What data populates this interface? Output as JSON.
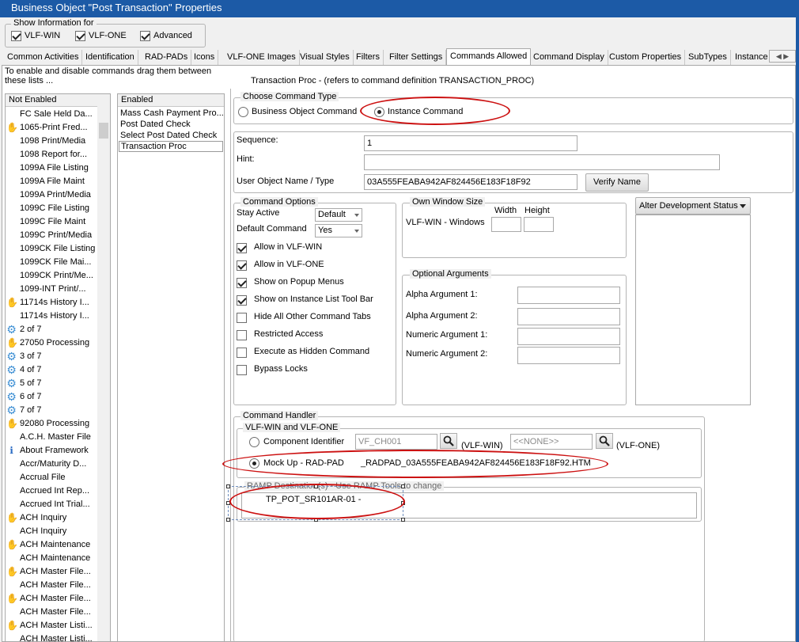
{
  "window": {
    "title": "Business Object \"Post Transaction\" Properties"
  },
  "show_info": {
    "legend": "Show Information for",
    "options": [
      {
        "label": "VLF-WIN",
        "checked": true
      },
      {
        "label": "VLF-ONE",
        "checked": true
      },
      {
        "label": "Advanced",
        "checked": true
      }
    ]
  },
  "tabs": [
    {
      "label": "Common Activities"
    },
    {
      "label": "Identification"
    },
    {
      "label": "RAD-PADs"
    },
    {
      "label": "Icons"
    },
    {
      "label": "VLF-ONE Images"
    },
    {
      "label": "Visual Styles"
    },
    {
      "label": "Filters"
    },
    {
      "label": "Filter Settings"
    },
    {
      "label": "Commands Allowed",
      "active": true
    },
    {
      "label": "Command Display"
    },
    {
      "label": "Custom Properties"
    },
    {
      "label": "SubTypes"
    },
    {
      "label": "Instance"
    }
  ],
  "instructions": "To enable and disable commands drag them between these lists ...",
  "transaction_header": "Transaction Proc - (refers to command definition TRANSACTION_PROC)",
  "not_enabled": {
    "header": "Not Enabled",
    "items": [
      {
        "label": "FC Sale Held Da...",
        "icon": "none"
      },
      {
        "label": "1065-Print Fred...",
        "icon": "hand-icon"
      },
      {
        "label": "1098 Print/Media",
        "icon": "none"
      },
      {
        "label": "1098 Report for...",
        "icon": "none"
      },
      {
        "label": "1099A File Listing",
        "icon": "none"
      },
      {
        "label": "1099A File Maint",
        "icon": "none"
      },
      {
        "label": "1099A Print/Media",
        "icon": "none"
      },
      {
        "label": "1099C File Listing",
        "icon": "none"
      },
      {
        "label": "1099C File Maint",
        "icon": "none"
      },
      {
        "label": "1099C Print/Media",
        "icon": "none"
      },
      {
        "label": "1099CK File Listing",
        "icon": "none"
      },
      {
        "label": "1099CK File Mai...",
        "icon": "none"
      },
      {
        "label": "1099CK Print/Me...",
        "icon": "none"
      },
      {
        "label": "1099-INT Print/...",
        "icon": "none"
      },
      {
        "label": "11714s History I...",
        "icon": "hand-icon"
      },
      {
        "label": "11714s History I...",
        "icon": "none"
      },
      {
        "label": "2 of 7",
        "icon": "gear-icon"
      },
      {
        "label": "27050 Processing",
        "icon": "hand-icon"
      },
      {
        "label": "3 of 7",
        "icon": "gear-icon"
      },
      {
        "label": "4 of 7",
        "icon": "gear-icon"
      },
      {
        "label": "5 of 7",
        "icon": "gear-icon"
      },
      {
        "label": "6 of 7",
        "icon": "gear-icon"
      },
      {
        "label": "7 of 7",
        "icon": "gear-icon"
      },
      {
        "label": "92080 Processing",
        "icon": "hand-icon"
      },
      {
        "label": "A.C.H. Master File",
        "icon": "none"
      },
      {
        "label": "About Framework",
        "icon": "info-icon"
      },
      {
        "label": "Accr/Maturity D...",
        "icon": "none"
      },
      {
        "label": "Accrual File",
        "icon": "none"
      },
      {
        "label": "Accrued Int Rep...",
        "icon": "none"
      },
      {
        "label": "Accrued Int Trial...",
        "icon": "none"
      },
      {
        "label": "ACH Inquiry",
        "icon": "hand-icon"
      },
      {
        "label": "ACH Inquiry",
        "icon": "none"
      },
      {
        "label": "ACH Maintenance",
        "icon": "hand-icon"
      },
      {
        "label": "ACH Maintenance",
        "icon": "none"
      },
      {
        "label": "ACH Master File...",
        "icon": "hand-icon"
      },
      {
        "label": "ACH Master File...",
        "icon": "none"
      },
      {
        "label": "ACH Master File...",
        "icon": "hand-icon"
      },
      {
        "label": "ACH Master File...",
        "icon": "none"
      },
      {
        "label": "ACH Master Listi...",
        "icon": "hand-icon"
      },
      {
        "label": "ACH Master Listi...",
        "icon": "none"
      }
    ]
  },
  "enabled": {
    "header": "Enabled",
    "items": [
      {
        "label": "Mass Cash Payment Pro..."
      },
      {
        "label": "Post Dated Check"
      },
      {
        "label": "Select Post Dated Check"
      },
      {
        "label": "Transaction Proc",
        "selected": true
      }
    ]
  },
  "command_type": {
    "legend": "Choose Command Type",
    "business_label": "Business Object Command",
    "instance_label": "Instance Command",
    "selected": "instance"
  },
  "details": {
    "sequence_label": "Sequence:",
    "sequence_value": "1",
    "hint_label": "Hint:",
    "hint_value": "",
    "user_object_label": "User Object Name / Type",
    "user_object_value": "03A555FEABA942AF824456E183F18F92",
    "verify_label": "Verify Name"
  },
  "command_options": {
    "legend": "Command Options",
    "stay_active_label": "Stay Active",
    "stay_active_value": "Default",
    "default_command_label": "Default Command",
    "default_command_value": "Yes",
    "checks": [
      {
        "label": "Allow in VLF-WIN",
        "checked": true
      },
      {
        "label": "Allow in VLF-ONE",
        "checked": true
      },
      {
        "label": "Show on Popup Menus",
        "checked": true
      },
      {
        "label": "Show on Instance List Tool Bar",
        "checked": true
      },
      {
        "label": "Hide All Other Command Tabs",
        "checked": false
      },
      {
        "label": "Restricted Access",
        "checked": false
      },
      {
        "label": "Execute as Hidden Command",
        "checked": false
      },
      {
        "label": "Bypass Locks",
        "checked": false
      }
    ]
  },
  "own_window": {
    "legend": "Own Window Size",
    "row_label": "VLF-WIN - Windows",
    "width_label": "Width",
    "height_label": "Height",
    "width_value": "",
    "height_value": ""
  },
  "optional_args": {
    "legend": "Optional Arguments",
    "rows": [
      {
        "label": "Alpha Argument 1:",
        "value": ""
      },
      {
        "label": "Alpha Argument 2:",
        "value": ""
      },
      {
        "label": "Numeric Argument 1:",
        "value": ""
      },
      {
        "label": "Numeric Argument 2:",
        "value": ""
      }
    ]
  },
  "alter_status": {
    "label": "Alter Development Status"
  },
  "handler": {
    "legend": "Command Handler",
    "sub_legend": "VLF-WIN and VLF-ONE",
    "component_label": "Component Identifier",
    "component_value": "VF_CH001",
    "vlf_win_label": "(VLF-WIN)",
    "one_value": "<<NONE>>",
    "vlf_one_label": "(VLF-ONE)",
    "mockup_label": "Mock Up - RAD-PAD",
    "mockup_value": "_RADPAD_03A555FEABA942AF824456E183F18F92.HTM",
    "selected": "mockup",
    "ramp_legend": "RAMP Destination(s) - Use RAMP Tools to change",
    "ramp_value": "TP_POT_SR101AR-01 -"
  },
  "annotation_color": "#cc1111",
  "accent_color": "#1c5aa6"
}
